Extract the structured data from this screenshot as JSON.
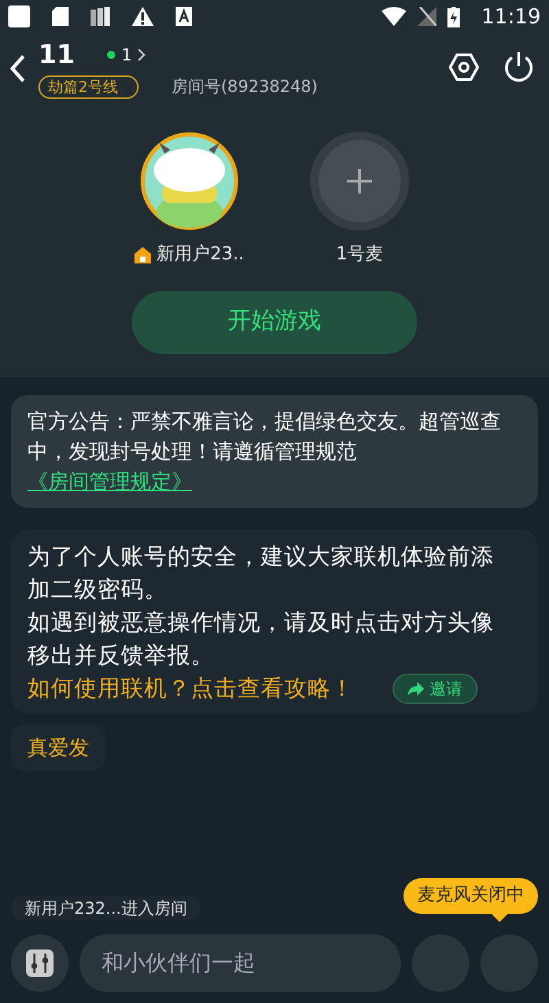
{
  "status_bar": {
    "time": "11:19"
  },
  "header": {
    "title": "11",
    "online_count": "1",
    "line_tag": "劫篇2号线",
    "room_id": "房间号(89238248)"
  },
  "seats": [
    {
      "kind": "user",
      "name": "新用户23..",
      "host": true
    },
    {
      "kind": "empty",
      "name": "1号麦",
      "host": false
    }
  ],
  "start_button": "开始游戏",
  "announcement": {
    "text": "官方公告：严禁不雅言论，提倡绿色交友。超管巡查中，发现封号处理！请遵循管理规范",
    "link": "《房间管理规定》"
  },
  "system_message": {
    "lines": [
      "为了个人账号的安全，建议大家联机体验前添加二级密码。",
      "如遇到被恶意操作情况，请及时点击对方头像移出并反馈举报。"
    ],
    "guide_link": "如何使用联机？点击查看攻略！",
    "invite_button": "邀请"
  },
  "chat_messages": [
    {
      "text": "真爱发"
    }
  ],
  "join_notice": "新用户232...进入房间",
  "mic_tooltip": "麦克风关闭中",
  "input": {
    "placeholder": "和小伙伴们一起"
  }
}
